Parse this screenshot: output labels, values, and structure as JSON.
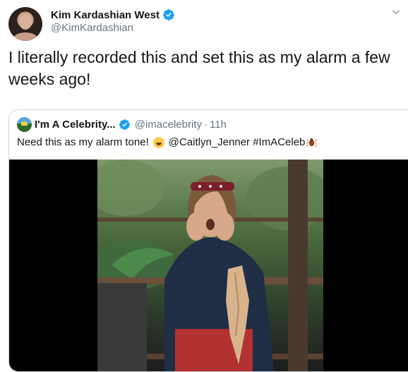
{
  "tweet": {
    "display_name": "Kim Kardashian West",
    "handle": "@KimKardashian",
    "text": "I literally recorded this and set this as my alarm a few weeks ago!",
    "verified_icon": "verified-badge-icon",
    "more_icon": "chevron-down-icon"
  },
  "quoted": {
    "display_name": "I'm A Celebrity...",
    "handle": "@imacelebrity",
    "separator": "·",
    "time": "11h",
    "text_part1": "Need this as my alarm tone!",
    "text_part2": "@Caitlyn_Jenner #ImACeleb",
    "emoji_1": "grinning-sweat-emoji",
    "emoji_2": "bug-emoji",
    "media": "video-thumbnail"
  },
  "colors": {
    "verified_blue": "#1da1f2",
    "secondary_text": "#657786",
    "border": "#ccd6dd"
  }
}
